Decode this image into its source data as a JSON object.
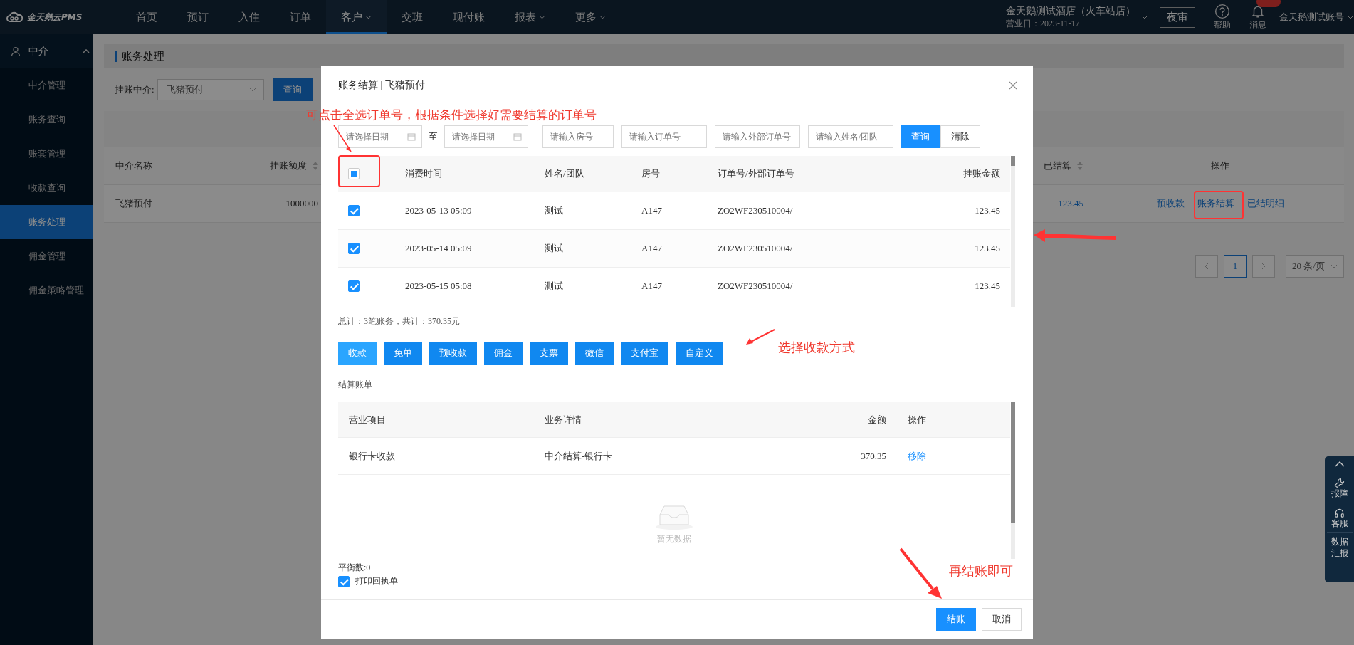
{
  "top_bar": {
    "logo": "金天鹅云PMS",
    "nav": [
      {
        "label": "首页",
        "selected": false,
        "has_menu": false
      },
      {
        "label": "预订",
        "selected": false,
        "has_menu": false
      },
      {
        "label": "入住",
        "selected": false,
        "has_menu": false
      },
      {
        "label": "订单",
        "selected": false,
        "has_menu": false
      },
      {
        "label": "客户",
        "selected": true,
        "has_menu": true
      },
      {
        "label": "交班",
        "selected": false,
        "has_menu": false
      },
      {
        "label": "现付账",
        "selected": false,
        "has_menu": false
      },
      {
        "label": "报表",
        "selected": false,
        "has_menu": true
      },
      {
        "label": "更多",
        "selected": false,
        "has_menu": true
      }
    ],
    "hotel_name": "金天鹅测试酒店（火车站店）",
    "business_date": "营业日：2023-11-17",
    "night_audit": "夜审",
    "help": "帮助",
    "messages": "消息",
    "account": "金天鹅测试账号"
  },
  "sidebar": {
    "group": {
      "label": "中介",
      "expanded": true
    },
    "items": [
      {
        "label": "中介管理",
        "selected": false
      },
      {
        "label": "账务查询",
        "selected": false
      },
      {
        "label": "账套管理",
        "selected": false
      },
      {
        "label": "收款查询",
        "selected": false
      },
      {
        "label": "账务处理",
        "selected": true
      },
      {
        "label": "佣金管理",
        "selected": false
      },
      {
        "label": "佣金策略管理",
        "selected": false
      }
    ]
  },
  "page": {
    "title": "账务处理",
    "filter": {
      "label": "挂账中介:",
      "value": "飞猪预付",
      "button": "查询"
    },
    "table": {
      "columns": [
        {
          "label": "中介名称",
          "sortable": false
        },
        {
          "label": "挂账额度",
          "sortable": true
        },
        {
          "label": "已结算",
          "sortable": true
        },
        {
          "label": "操作",
          "sortable": false
        }
      ],
      "rows": [
        {
          "name": "飞猪预付",
          "credit_limit": "1000000",
          "settled": "123.45",
          "actions": [
            "预收款",
            "账务结算",
            "已结明细"
          ]
        }
      ]
    },
    "pagination": {
      "pages": [
        {
          "label": "1",
          "selected": true
        }
      ],
      "page_size": "20 条/页"
    }
  },
  "modal": {
    "title": "账务结算 | 飞猪预付",
    "filters": [
      {
        "kind": "date",
        "placeholder": "请选择日期"
      },
      {
        "kind": "separator",
        "text": "至"
      },
      {
        "kind": "date",
        "placeholder": "请选择日期"
      },
      {
        "kind": "text",
        "placeholder": "请输入房号"
      },
      {
        "kind": "text",
        "placeholder": "请输入订单号"
      },
      {
        "kind": "text",
        "placeholder": "请输入外部订单号"
      },
      {
        "kind": "text",
        "placeholder": "请输入姓名/团队"
      }
    ],
    "search_button": "查询",
    "clear_button": "清除",
    "orders": {
      "select_all": {
        "checked": false,
        "indeterminate": true
      },
      "columns": [
        "消费时间",
        "姓名/团队",
        "房号",
        "订单号/外部订单号",
        "挂账金额"
      ],
      "rows": [
        {
          "checked": true,
          "time": "2023-05-13 05:09",
          "name": "测试",
          "room": "A147",
          "order_no": "ZO2WF230510004/",
          "amount": "123.45"
        },
        {
          "checked": true,
          "time": "2023-05-14 05:09",
          "name": "测试",
          "room": "A147",
          "order_no": "ZO2WF230510004/",
          "amount": "123.45"
        },
        {
          "checked": true,
          "time": "2023-05-15 05:08",
          "name": "测试",
          "room": "A147",
          "order_no": "ZO2WF230510004/",
          "amount": "123.45"
        }
      ]
    },
    "summary": "总计：3笔账务，共计：370.35元",
    "payment_methods": [
      {
        "label": "收款",
        "selected": true
      },
      {
        "label": "免单",
        "selected": false
      },
      {
        "label": "预收款",
        "selected": false
      },
      {
        "label": "佣金",
        "selected": false
      },
      {
        "label": "支票",
        "selected": false
      },
      {
        "label": "微信",
        "selected": false
      },
      {
        "label": "支付宝",
        "selected": false
      },
      {
        "label": "自定义",
        "selected": false
      }
    ],
    "bill_title": "结算账单",
    "bill": {
      "columns": [
        "营业项目",
        "业务详情",
        "金额",
        "操作"
      ],
      "rows": [
        {
          "item": "银行卡收款",
          "detail": "中介结算-银行卡",
          "amount": "370.35",
          "action": "移除"
        }
      ],
      "empty_text": "暂无数据"
    },
    "balance": "平衡数:0",
    "print_receipt": {
      "label": "打印回执单",
      "checked": true
    },
    "buttons": {
      "confirm": "结账",
      "cancel": "取消"
    }
  },
  "float_panel": {
    "items": [
      {
        "kind": "repair",
        "label": "报障"
      },
      {
        "kind": "service",
        "label": "客服"
      },
      {
        "kind": "report",
        "label": "数据汇报"
      }
    ]
  },
  "annotations": {
    "select_orders": "可点击全选订单号，根据条件选择好需要结算的订单号",
    "payment_method": "选择收款方式",
    "checkout": "再结账即可"
  }
}
